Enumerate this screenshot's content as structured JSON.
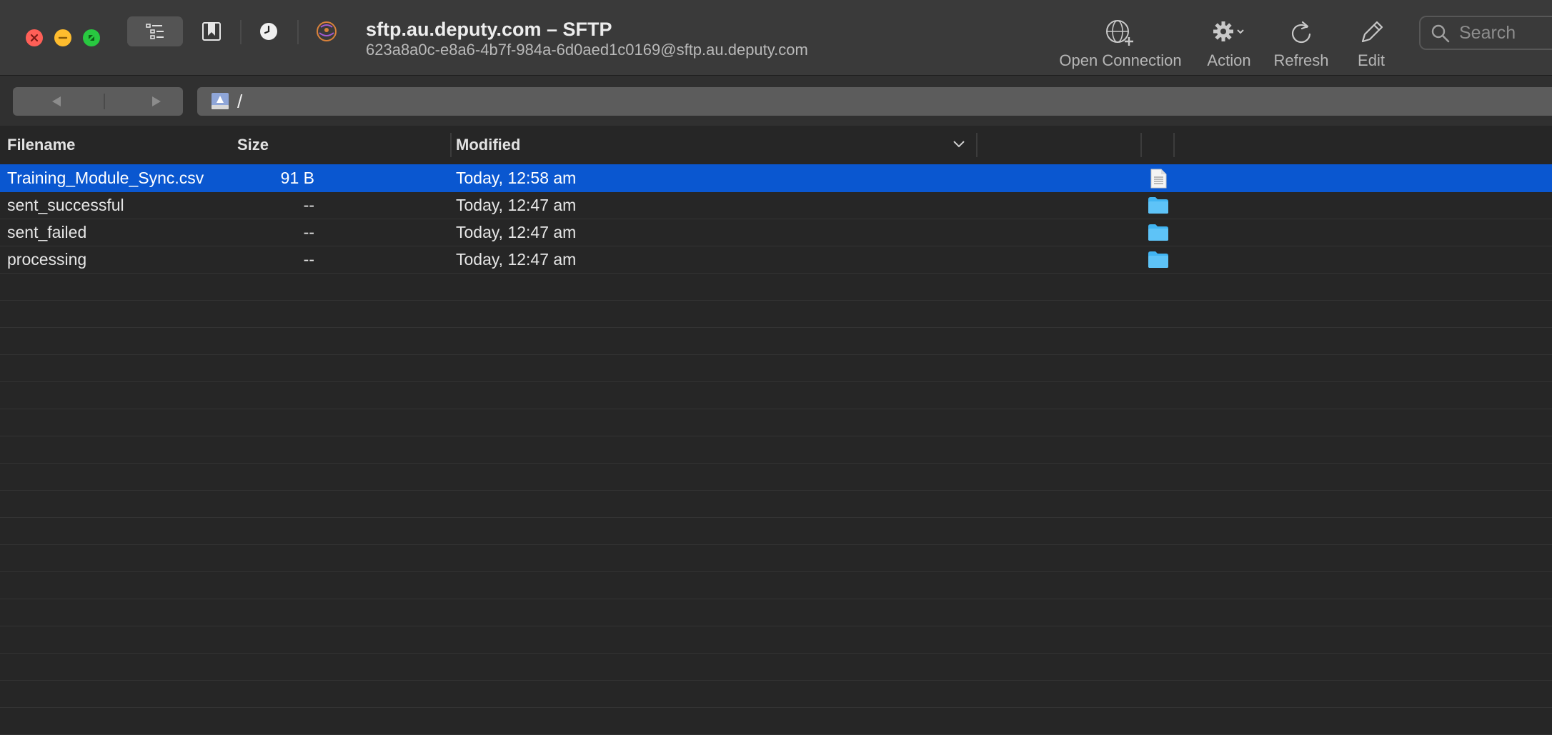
{
  "window": {
    "title": "sftp.au.deputy.com – SFTP",
    "subtitle": "623a8a0c-e8a6-4b7f-984a-6d0aed1c0169@sftp.au.deputy.com"
  },
  "toolbar": {
    "open_connection": "Open Connection",
    "action": "Action",
    "refresh": "Refresh",
    "edit": "Edit",
    "search_placeholder": "Search"
  },
  "navigation": {
    "path": "/"
  },
  "table": {
    "columns": {
      "filename": "Filename",
      "size": "Size",
      "modified": "Modified"
    },
    "rows": [
      {
        "name": "Training_Module_Sync.csv",
        "size": "91 B",
        "modified": "Today, 12:58 am",
        "kind": "file",
        "selected": true
      },
      {
        "name": "sent_successful",
        "size": "--",
        "modified": "Today, 12:47 am",
        "kind": "folder",
        "selected": false
      },
      {
        "name": "sent_failed",
        "size": "--",
        "modified": "Today, 12:47 am",
        "kind": "folder",
        "selected": false
      },
      {
        "name": "processing",
        "size": "--",
        "modified": "Today, 12:47 am",
        "kind": "folder",
        "selected": false
      }
    ]
  },
  "colors": {
    "selection": "#0a57d0",
    "folder": "#41b4f2",
    "close": "#ff5f57",
    "minimize": "#febc2e",
    "maximize": "#28c840"
  }
}
